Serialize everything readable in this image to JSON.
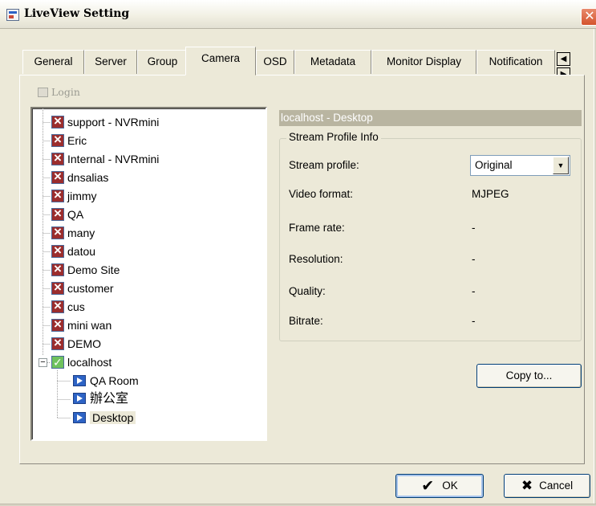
{
  "window": {
    "title": "LiveView Setting"
  },
  "tabs": [
    "General",
    "Server",
    "Group",
    "Camera",
    "OSD",
    "Metadata",
    "Monitor Display",
    "Notification"
  ],
  "active_tab": "Camera",
  "toolbar": {
    "login_label": "Login"
  },
  "tree": {
    "servers": [
      "support - NVRmini",
      "Eric",
      "Internal - NVRmini",
      "dnsalias",
      "jimmy",
      "QA",
      "many",
      "datou",
      "Demo Site",
      "customer",
      "cus",
      "mini wan",
      "DEMO"
    ],
    "connected_server": "localhost",
    "cameras": [
      "QA Room",
      "辦公室",
      "Desktop"
    ],
    "selected": "Desktop"
  },
  "detail": {
    "header": "localhost - Desktop",
    "group_title": "Stream Profile Info",
    "fields": [
      {
        "label": "Stream profile:",
        "value": "Original"
      },
      {
        "label": "Video format:",
        "value": "MJPEG"
      },
      {
        "label": "Frame rate:",
        "value": "-"
      },
      {
        "label": "Resolution:",
        "value": "-"
      },
      {
        "label": "Quality:",
        "value": "-"
      },
      {
        "label": "Bitrate:",
        "value": "-"
      }
    ],
    "copy_button": "Copy to..."
  },
  "buttons": {
    "ok": "OK",
    "cancel": "Cancel"
  }
}
